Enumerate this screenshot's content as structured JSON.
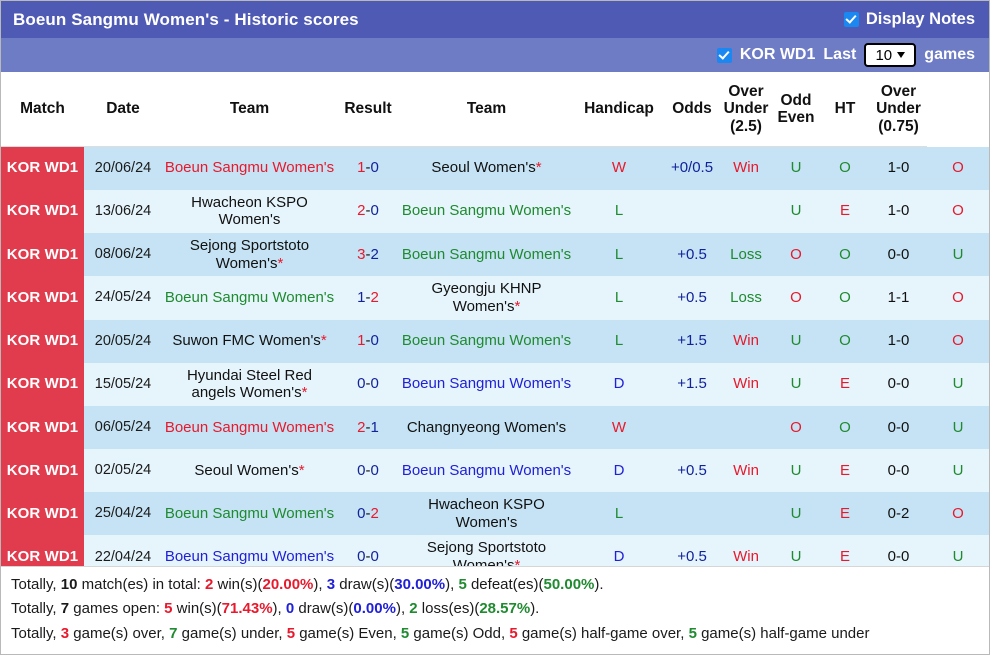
{
  "titlebar": {
    "title": "Boeun Sangmu Women's - Historic scores",
    "display_notes_label": "Display Notes",
    "display_notes_checked": true,
    "checkbox_color": "#1b87f0",
    "background_color": "#4e5ab4"
  },
  "subbar": {
    "league_checked": true,
    "league_label": "KOR WD1",
    "last_label": "Last",
    "games_select_value": "10",
    "games_label": "games",
    "background_color": "#6e7cc6"
  },
  "table": {
    "columns": [
      "Match",
      "Date",
      "Team",
      "Result",
      "Team",
      "Handicap",
      "Odds",
      "Over\nUnder\n(2.5)",
      "Odd\nEven",
      "HT",
      "Over\nUnder\n(0.75)"
    ],
    "columns_multiline": {
      "over_under_25": [
        "Over",
        "Under",
        "(2.5)"
      ],
      "odd_even": [
        "Odd",
        "Even"
      ],
      "over_under_075": [
        "Over",
        "Under",
        "(0.75)"
      ]
    },
    "rows": [
      {
        "match": "KOR WD1",
        "date": "20/06/24",
        "home_team": "Boeun Sangmu Women's",
        "home_team_color": "red",
        "home_star": false,
        "score_home": "1",
        "score_away": "0",
        "score_home_color": "red",
        "score_away_color": "navy",
        "away_team": "Seoul Women's",
        "away_team_color": "black",
        "away_star": true,
        "result": "W",
        "result_color": "red",
        "handicap": "+0/0.5",
        "odds": "Win",
        "odds_color": "red",
        "over_under_25": "U",
        "over_under_25_color": "green",
        "odd_even": "O",
        "odd_even_color": "green",
        "ht": "1-0",
        "over_under_075": "O",
        "over_under_075_color": "red"
      },
      {
        "match": "KOR WD1",
        "date": "13/06/24",
        "home_team": "Hwacheon KSPO Women's",
        "home_team_color": "black",
        "home_star": false,
        "score_home": "2",
        "score_away": "0",
        "score_home_color": "red",
        "score_away_color": "navy",
        "away_team": "Boeun Sangmu Women's",
        "away_team_color": "green",
        "away_star": false,
        "result": "L",
        "result_color": "green",
        "handicap": "",
        "odds": "",
        "odds_color": "black",
        "over_under_25": "U",
        "over_under_25_color": "green",
        "odd_even": "E",
        "odd_even_color": "red",
        "ht": "1-0",
        "over_under_075": "O",
        "over_under_075_color": "red"
      },
      {
        "match": "KOR WD1",
        "date": "08/06/24",
        "home_team": "Sejong Sportstoto Women's",
        "home_team_color": "black",
        "home_star": true,
        "score_home": "3",
        "score_away": "2",
        "score_home_color": "red",
        "score_away_color": "navy",
        "away_team": "Boeun Sangmu Women's",
        "away_team_color": "green",
        "away_star": false,
        "result": "L",
        "result_color": "green",
        "handicap": "+0.5",
        "odds": "Loss",
        "odds_color": "green",
        "over_under_25": "O",
        "over_under_25_color": "red",
        "odd_even": "O",
        "odd_even_color": "green",
        "ht": "0-0",
        "over_under_075": "U",
        "over_under_075_color": "green"
      },
      {
        "match": "KOR WD1",
        "date": "24/05/24",
        "home_team": "Boeun Sangmu Women's",
        "home_team_color": "green",
        "home_star": false,
        "score_home": "1",
        "score_away": "2",
        "score_home_color": "navy",
        "score_away_color": "red",
        "away_team": "Gyeongju KHNP Women's",
        "away_team_color": "black",
        "away_star": true,
        "result": "L",
        "result_color": "green",
        "handicap": "+0.5",
        "odds": "Loss",
        "odds_color": "green",
        "over_under_25": "O",
        "over_under_25_color": "red",
        "odd_even": "O",
        "odd_even_color": "green",
        "ht": "1-1",
        "over_under_075": "O",
        "over_under_075_color": "red"
      },
      {
        "match": "KOR WD1",
        "date": "20/05/24",
        "home_team": "Suwon FMC Women's",
        "home_team_color": "black",
        "home_star": true,
        "score_home": "1",
        "score_away": "0",
        "score_home_color": "red",
        "score_away_color": "navy",
        "away_team": "Boeun Sangmu Women's",
        "away_team_color": "green",
        "away_star": false,
        "result": "L",
        "result_color": "green",
        "handicap": "+1.5",
        "odds": "Win",
        "odds_color": "red",
        "over_under_25": "U",
        "over_under_25_color": "green",
        "odd_even": "O",
        "odd_even_color": "green",
        "ht": "1-0",
        "over_under_075": "O",
        "over_under_075_color": "red"
      },
      {
        "match": "KOR WD1",
        "date": "15/05/24",
        "home_team": "Hyundai Steel Red angels Women's",
        "home_team_color": "black",
        "home_star": true,
        "score_home": "0",
        "score_away": "0",
        "score_home_color": "navy",
        "score_away_color": "navy",
        "away_team": "Boeun Sangmu Women's",
        "away_team_color": "blue",
        "away_star": false,
        "result": "D",
        "result_color": "blue",
        "handicap": "+1.5",
        "odds": "Win",
        "odds_color": "red",
        "over_under_25": "U",
        "over_under_25_color": "green",
        "odd_even": "E",
        "odd_even_color": "red",
        "ht": "0-0",
        "over_under_075": "U",
        "over_under_075_color": "green"
      },
      {
        "match": "KOR WD1",
        "date": "06/05/24",
        "home_team": "Boeun Sangmu Women's",
        "home_team_color": "red",
        "home_star": false,
        "score_home": "2",
        "score_away": "1",
        "score_home_color": "red",
        "score_away_color": "navy",
        "away_team": "Changnyeong Women's",
        "away_team_color": "black",
        "away_star": false,
        "result": "W",
        "result_color": "red",
        "handicap": "",
        "odds": "",
        "odds_color": "black",
        "over_under_25": "O",
        "over_under_25_color": "red",
        "odd_even": "O",
        "odd_even_color": "green",
        "ht": "0-0",
        "over_under_075": "U",
        "over_under_075_color": "green"
      },
      {
        "match": "KOR WD1",
        "date": "02/05/24",
        "home_team": "Seoul Women's",
        "home_team_color": "black",
        "home_star": true,
        "score_home": "0",
        "score_away": "0",
        "score_home_color": "navy",
        "score_away_color": "navy",
        "away_team": "Boeun Sangmu Women's",
        "away_team_color": "blue",
        "away_star": false,
        "result": "D",
        "result_color": "blue",
        "handicap": "+0.5",
        "odds": "Win",
        "odds_color": "red",
        "over_under_25": "U",
        "over_under_25_color": "green",
        "odd_even": "E",
        "odd_even_color": "red",
        "ht": "0-0",
        "over_under_075": "U",
        "over_under_075_color": "green"
      },
      {
        "match": "KOR WD1",
        "date": "25/04/24",
        "home_team": "Boeun Sangmu Women's",
        "home_team_color": "green",
        "home_star": false,
        "score_home": "0",
        "score_away": "2",
        "score_home_color": "navy",
        "score_away_color": "red",
        "away_team": "Hwacheon KSPO Women's",
        "away_team_color": "black",
        "away_star": false,
        "result": "L",
        "result_color": "green",
        "handicap": "",
        "odds": "",
        "odds_color": "black",
        "over_under_25": "U",
        "over_under_25_color": "green",
        "odd_even": "E",
        "odd_even_color": "red",
        "ht": "0-2",
        "over_under_075": "O",
        "over_under_075_color": "red"
      },
      {
        "match": "KOR WD1",
        "date": "22/04/24",
        "home_team": "Boeun Sangmu Women's",
        "home_team_color": "blue",
        "home_star": false,
        "score_home": "0",
        "score_away": "0",
        "score_home_color": "navy",
        "score_away_color": "navy",
        "away_team": "Sejong Sportstoto Women's",
        "away_team_color": "black",
        "away_star": true,
        "result": "D",
        "result_color": "blue",
        "handicap": "+0.5",
        "odds": "Win",
        "odds_color": "red",
        "over_under_25": "U",
        "over_under_25_color": "green",
        "odd_even": "E",
        "odd_even_color": "red",
        "ht": "0-0",
        "over_under_075": "U",
        "over_under_075_color": "green"
      }
    ]
  },
  "summary": {
    "line1": {
      "prefix": "Totally, ",
      "total": "10",
      "total_suffix": " match(es) in total: ",
      "wins": "2",
      "wins_word": " win(s)(",
      "wins_pct": "20.00%",
      "draws": "3",
      "draws_word": " draw(s)(",
      "draws_pct": "30.00%",
      "defeats": "5",
      "defeats_word": " defeat(es)(",
      "defeats_pct": "50.00%"
    },
    "line2": {
      "prefix": "Totally, ",
      "open": "7",
      "open_suffix": " games open: ",
      "wins": "5",
      "wins_word": " win(s)(",
      "wins_pct": "71.43%",
      "draws": "0",
      "draws_word": " draw(s)(",
      "draws_pct": "0.00%",
      "losses": "2",
      "losses_word": " loss(es)(",
      "losses_pct": "28.57%"
    },
    "line3": {
      "prefix": "Totally, ",
      "over": "3",
      "over_word": " game(s) over, ",
      "under": "7",
      "under_word": " game(s) under, ",
      "even": "5",
      "even_word": " game(s) Even, ",
      "odd": "5",
      "odd_word": " game(s) Odd, ",
      "half_over": "5",
      "half_over_word": " game(s) half-game over, ",
      "half_under": "5",
      "half_under_word": " game(s) half-game under"
    }
  }
}
